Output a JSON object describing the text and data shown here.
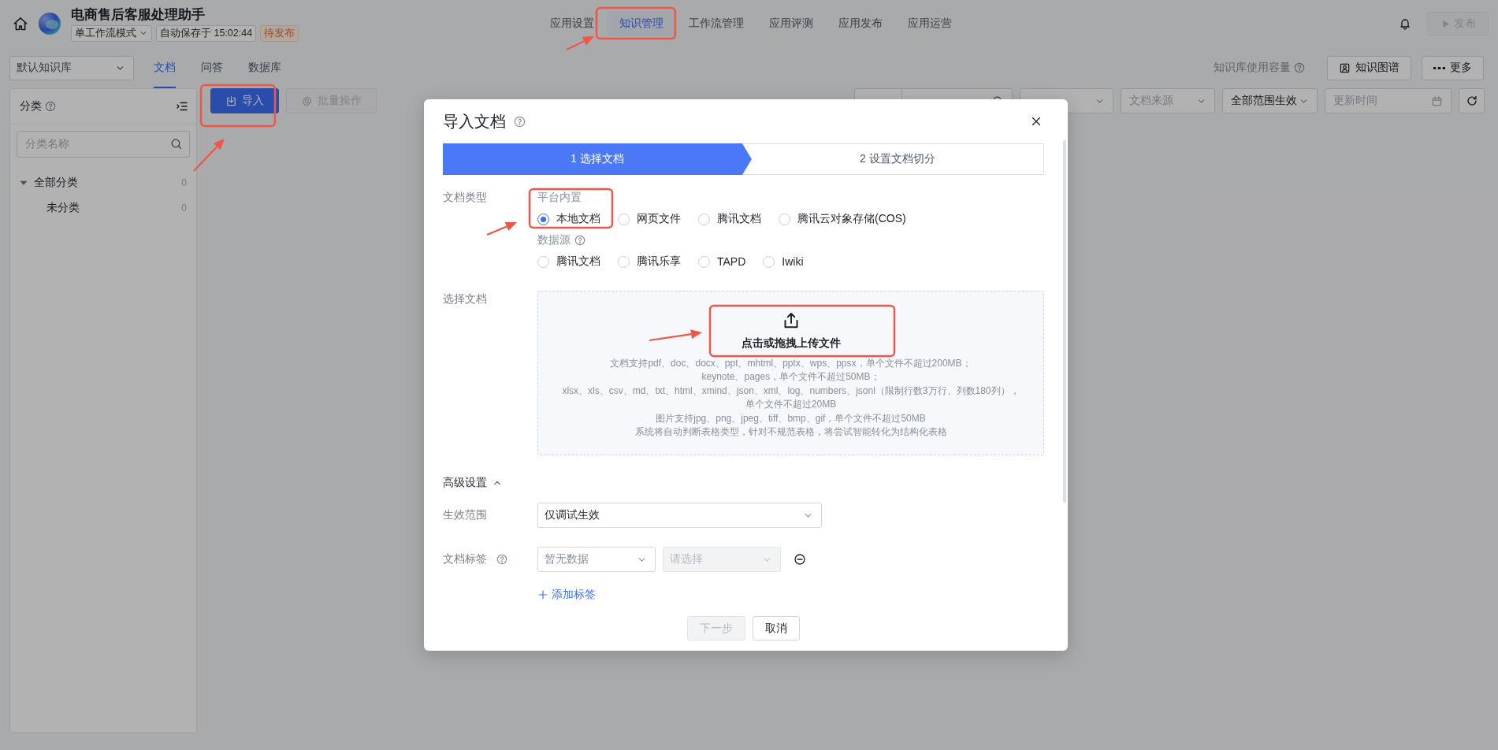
{
  "app": {
    "title": "电商售后客服处理助手",
    "mode": "单工作流模式",
    "autosave": "自动保存于 15:02:44",
    "status": "待发布"
  },
  "nav_tabs": [
    {
      "label": "应用设置",
      "selected": false
    },
    {
      "label": "知识管理",
      "selected": true
    },
    {
      "label": "工作流管理",
      "selected": false
    },
    {
      "label": "应用评测",
      "selected": false
    },
    {
      "label": "应用发布",
      "selected": false
    },
    {
      "label": "应用运营",
      "selected": false
    }
  ],
  "publish_button": {
    "label": "发布",
    "disabled": true
  },
  "knowledge_base_select": {
    "value": "默认知识库"
  },
  "content_tabs": [
    {
      "label": "文档",
      "selected": true
    },
    {
      "label": "问答",
      "selected": false
    },
    {
      "label": "数据库",
      "selected": false
    }
  ],
  "capacity_label": "知识库使用容量",
  "toolbar_buttons": [
    {
      "kind": "graph",
      "label": "知识图谱"
    },
    {
      "kind": "more",
      "label": "更多"
    }
  ],
  "sidebar": {
    "title": "分类",
    "search_placeholder": "分类名称",
    "tree": [
      {
        "label": "全部分类",
        "count": "0",
        "expanded": true,
        "children": [
          {
            "label": "未分类",
            "count": "0"
          }
        ]
      }
    ]
  },
  "actions": [
    {
      "kind": "import",
      "label": "导入",
      "disabled": false
    },
    {
      "kind": "batch",
      "label": "批量操作",
      "disabled": true
    }
  ],
  "filters": [
    {
      "kind": "keyword"
    },
    {
      "kind": "select"
    },
    {
      "kind": "select",
      "placeholder": "文档来源"
    },
    {
      "kind": "select",
      "value": "全部范围生效"
    },
    {
      "kind": "date",
      "placeholder": "更新时间"
    },
    {
      "kind": "refresh"
    }
  ],
  "dialog": {
    "title": "导入文档",
    "steps": [
      {
        "label": "1 选择文档",
        "selected": true
      },
      {
        "label": "2 设置文档切分",
        "selected": false
      }
    ],
    "doc_type": {
      "label": "文档类型",
      "groups": [
        {
          "title": "平台内置",
          "help": false,
          "options": [
            {
              "label": "本地文档",
              "selected": true
            },
            {
              "label": "网页文件",
              "selected": false
            },
            {
              "label": "腾讯文档",
              "selected": false
            },
            {
              "label": "腾讯云对象存储(COS)",
              "selected": false
            }
          ]
        },
        {
          "title": "数据源",
          "help": true,
          "options": [
            {
              "label": "腾讯文档",
              "selected": false
            },
            {
              "label": "腾讯乐享",
              "selected": false
            },
            {
              "label": "TAPD",
              "selected": false
            },
            {
              "label": "Iwiki",
              "selected": false
            }
          ]
        }
      ]
    },
    "upload": {
      "label": "选择文档",
      "action": "点击或拖拽上传文件",
      "notes": [
        "文档支持pdf、doc、docx、ppt、mhtml、pptx、wps、ppsx，单个文件不超过200MB；",
        "keynote、pages，单个文件不超过50MB；",
        "xlsx、xls、csv、md、txt、html、xmind、json、xml、log、numbers、jsonl（限制行数3万行、列数180列），",
        "单个文件不超过20MB",
        "图片支持jpg、png、jpeg、tiff、bmp、gif，单个文件不超过50MB",
        "系统将自动判断表格类型，针对不规范表格，将尝试智能转化为结构化表格"
      ]
    },
    "advanced": {
      "title": "高级设置",
      "expanded": true,
      "scope": {
        "label": "生效范围",
        "value": "仅调试生效"
      },
      "tags": {
        "label": "文档标签",
        "key_placeholder": "暂无数据",
        "value_placeholder": "请选择",
        "value_disabled": true,
        "add_label": "添加标签"
      }
    },
    "buttons": [
      {
        "label": "下一步",
        "disabled": true
      },
      {
        "label": "取消",
        "disabled": false
      }
    ]
  }
}
